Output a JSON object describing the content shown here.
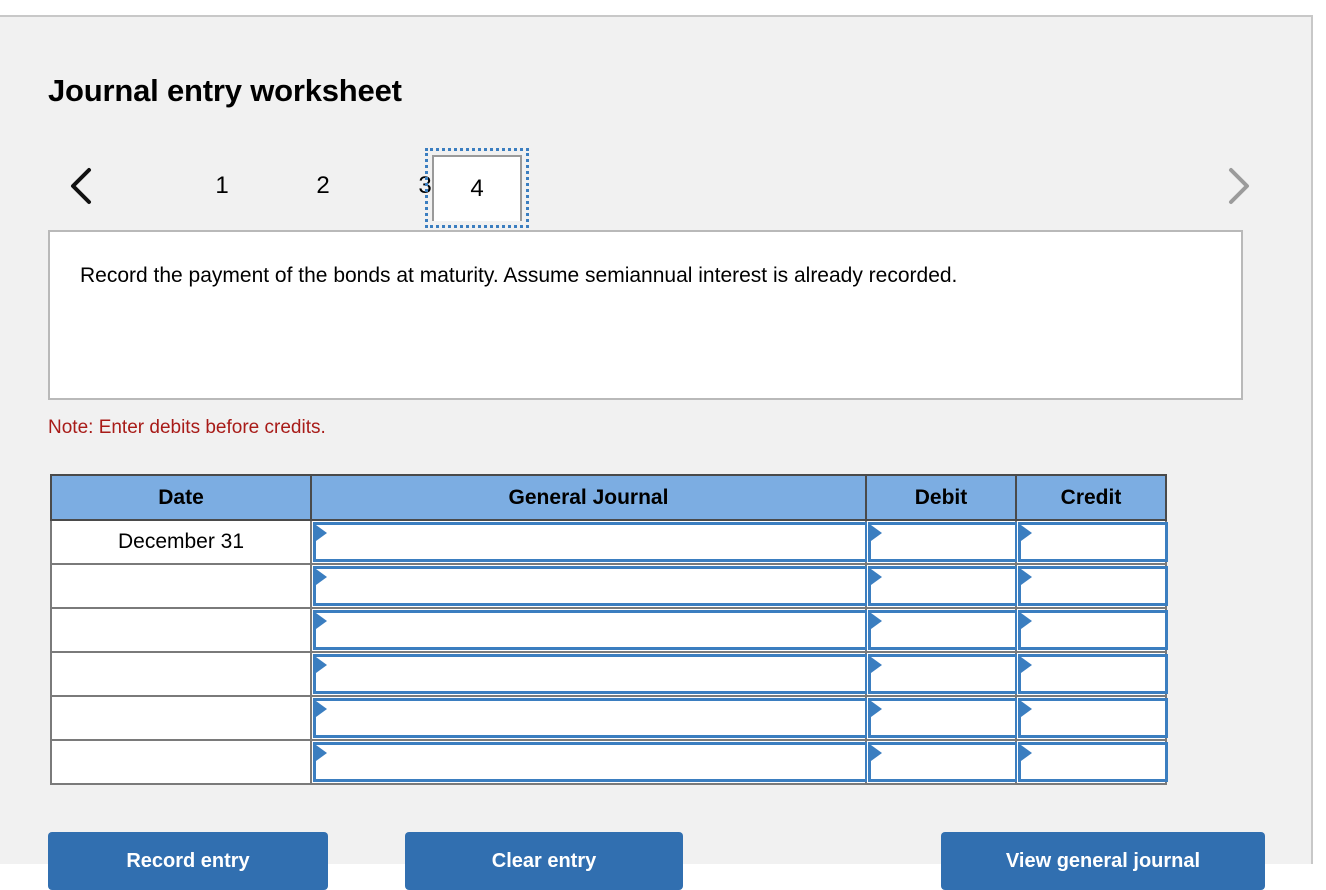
{
  "page": {
    "title": "Journal entry worksheet",
    "background_color": "#f1f1f1",
    "accent_color": "#316fb0",
    "header_color": "#7cade2",
    "note_color": "#a81b18"
  },
  "pager": {
    "prev_icon": "chevron-left-icon",
    "next_icon": "chevron-right-icon",
    "tabs": [
      {
        "label": "1",
        "selected": false
      },
      {
        "label": "2",
        "selected": false
      },
      {
        "label": "3",
        "selected": false
      },
      {
        "label": "4",
        "selected": true
      }
    ]
  },
  "instruction": {
    "text": "Record the payment of the bonds at maturity. Assume semiannual interest is already recorded."
  },
  "note": {
    "text": "Note: Enter debits before credits."
  },
  "journal": {
    "columns": [
      "Date",
      "General Journal",
      "Debit",
      "Credit"
    ],
    "rows": [
      {
        "date": "December 31",
        "general_journal": "",
        "debit": "",
        "credit": ""
      },
      {
        "date": "",
        "general_journal": "",
        "debit": "",
        "credit": ""
      },
      {
        "date": "",
        "general_journal": "",
        "debit": "",
        "credit": ""
      },
      {
        "date": "",
        "general_journal": "",
        "debit": "",
        "credit": ""
      },
      {
        "date": "",
        "general_journal": "",
        "debit": "",
        "credit": ""
      },
      {
        "date": "",
        "general_journal": "",
        "debit": "",
        "credit": ""
      }
    ]
  },
  "actions": {
    "record_entry": "Record entry",
    "clear_entry": "Clear entry",
    "view_general_journal": "View general journal"
  }
}
